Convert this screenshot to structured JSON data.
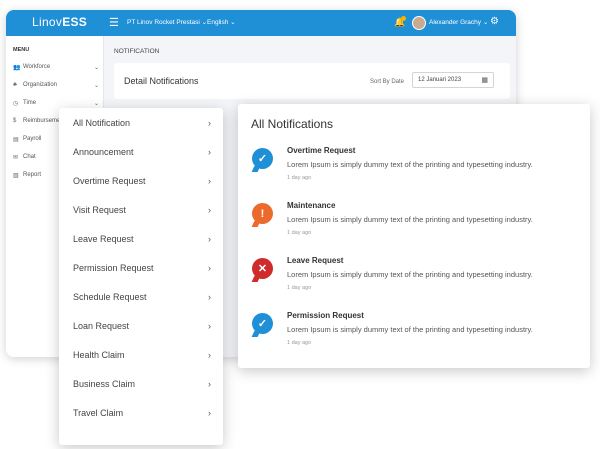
{
  "app": {
    "logo_prefix": "Linov",
    "logo_suffix": "ESS",
    "company": "PT Linov Rocket Prestasi",
    "language": "English",
    "user_name": "Alexander Grachy",
    "colors": {
      "primary": "#1f8fd6",
      "success": "#1f8fd6",
      "warning": "#ec6a2c",
      "error": "#cf2b2b"
    }
  },
  "sidebar": {
    "menu_label": "MENU",
    "items": [
      {
        "label": "Workforce",
        "icon": "people-icon",
        "has_chevron": true
      },
      {
        "label": "Organization",
        "icon": "organization-icon",
        "has_chevron": true
      },
      {
        "label": "Time",
        "icon": "clock-icon",
        "has_chevron": true
      },
      {
        "label": "Reimbursement",
        "icon": "money-icon",
        "has_chevron": false
      },
      {
        "label": "Payroll",
        "icon": "payroll-icon",
        "has_chevron": false
      },
      {
        "label": "Chat",
        "icon": "chat-icon",
        "has_chevron": false
      },
      {
        "label": "Report",
        "icon": "report-icon",
        "has_chevron": false
      }
    ]
  },
  "main": {
    "section_title": "NOTIFICATION",
    "detail_title": "Detail Notifications",
    "sort_label": "Sort By Date",
    "date_value": "12 Januari 2023"
  },
  "categories": [
    "All Notification",
    "Announcement",
    "Overtime Request",
    "Visit Request",
    "Leave Request",
    "Permission Request",
    "Schedule Request",
    "Loan Request",
    "Health Claim",
    "Business Claim",
    "Travel Claim"
  ],
  "notifications": {
    "title": "All Notifications",
    "items": [
      {
        "title": "Overtime Request",
        "body": "Lorem Ipsum is simply dummy text of the printing and typesetting industry.",
        "time": "1 day ago",
        "status": "success",
        "icon": "check-icon"
      },
      {
        "title": "Maintenance",
        "body": "Lorem Ipsum is simply dummy text of the printing and typesetting industry.",
        "time": "1 day ago",
        "status": "warning",
        "icon": "exclamation-icon"
      },
      {
        "title": "Leave Request",
        "body": "Lorem Ipsum is simply dummy text of the printing and typesetting industry.",
        "time": "1 day ago",
        "status": "error",
        "icon": "close-icon"
      },
      {
        "title": "Permission Request",
        "body": "Lorem Ipsum is simply dummy text of the printing and typesetting industry.",
        "time": "1 day ago",
        "status": "success",
        "icon": "check-icon"
      }
    ]
  }
}
